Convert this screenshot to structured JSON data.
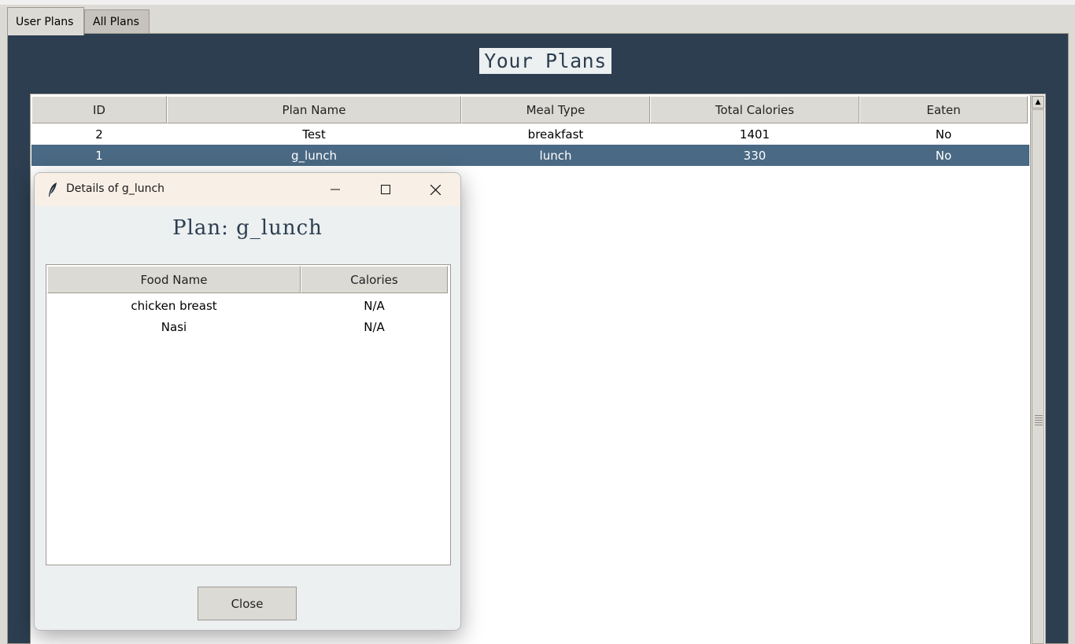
{
  "tabs": [
    {
      "label": "User Plans",
      "active": true
    },
    {
      "label": "All Plans",
      "active": false
    }
  ],
  "panel": {
    "title": "Your Plans"
  },
  "plans_table": {
    "columns": [
      "ID",
      "Plan Name",
      "Meal Type",
      "Total Calories",
      "Eaten"
    ],
    "rows": [
      {
        "id": "2",
        "name": "Test",
        "meal": "breakfast",
        "calories": "1401",
        "eaten": "No",
        "selected": false
      },
      {
        "id": "1",
        "name": "g_lunch",
        "meal": "lunch",
        "calories": "330",
        "eaten": "No",
        "selected": true
      }
    ]
  },
  "dialog": {
    "window_title": "Details of g_lunch",
    "heading": "Plan: g_lunch",
    "columns": [
      "Food Name",
      "Calories"
    ],
    "rows": [
      {
        "food": "chicken breast",
        "calories": "N/A"
      },
      {
        "food": "Nasi",
        "calories": "N/A"
      }
    ],
    "close_label": "Close"
  },
  "colors": {
    "panel_bg": "#2c3e50",
    "selection": "#4a6984",
    "dialog_bg": "#ecf0f1",
    "titlebar_bg": "#f8efe6"
  },
  "icons": [
    "feather-icon",
    "minimize-icon",
    "maximize-icon",
    "close-icon",
    "scroll-up-arrow-icon"
  ]
}
